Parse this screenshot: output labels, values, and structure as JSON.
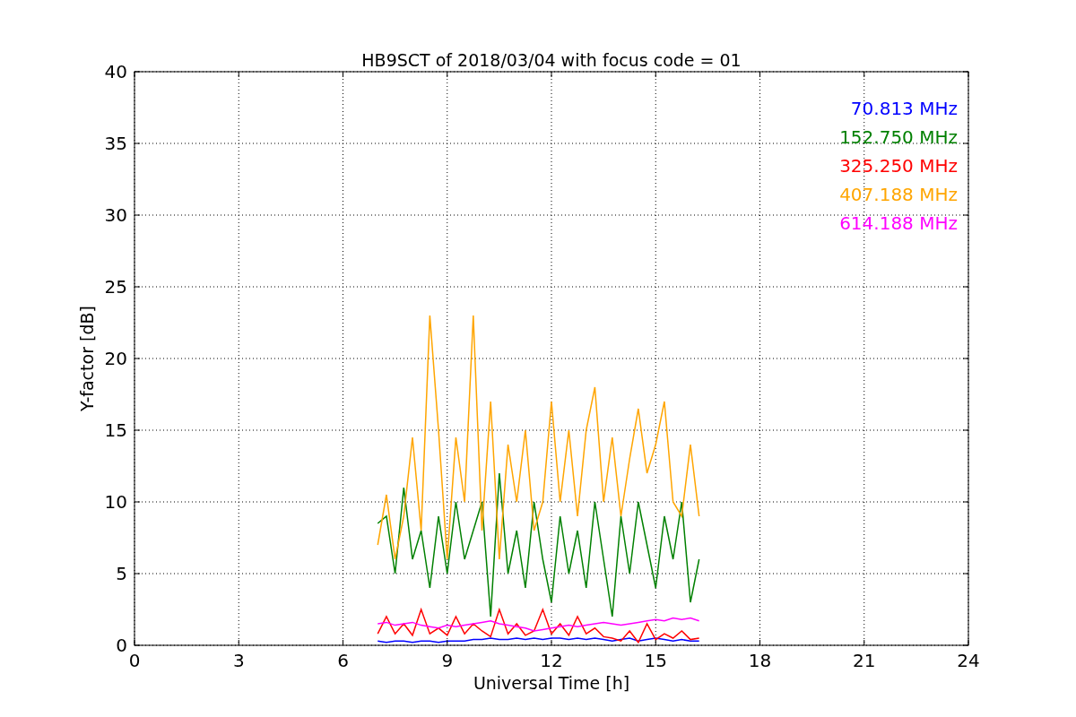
{
  "chart_data": {
    "type": "line",
    "title": "HB9SCT of 2018/03/04 with focus code = 01",
    "xlabel": "Universal Time [h]",
    "ylabel": "Y-factor [dB]",
    "x": [
      7,
      7.25,
      7.5,
      7.75,
      8,
      8.25,
      8.5,
      8.75,
      9,
      9.25,
      9.5,
      9.75,
      10,
      10.25,
      10.5,
      10.75,
      11,
      11.25,
      11.5,
      11.75,
      12,
      12.25,
      12.5,
      12.75,
      13,
      13.25,
      13.5,
      13.75,
      14,
      14.25,
      14.5,
      14.75,
      15,
      15.25,
      15.5,
      15.75,
      16,
      16.25
    ],
    "series": [
      {
        "name": "70.813 MHz",
        "color": "#0000ff",
        "values": [
          0.3,
          0.2,
          0.3,
          0.3,
          0.2,
          0.3,
          0.3,
          0.2,
          0.3,
          0.3,
          0.3,
          0.4,
          0.4,
          0.5,
          0.4,
          0.4,
          0.5,
          0.4,
          0.5,
          0.4,
          0.5,
          0.5,
          0.4,
          0.5,
          0.4,
          0.5,
          0.4,
          0.3,
          0.4,
          0.5,
          0.3,
          0.4,
          0.5,
          0.4,
          0.3,
          0.4,
          0.3,
          0.3
        ]
      },
      {
        "name": "152.750 MHz",
        "color": "#008000",
        "values": [
          8.5,
          9,
          5,
          11,
          6,
          8,
          4,
          9,
          5,
          10,
          6,
          8,
          10,
          2,
          12,
          5,
          8,
          4,
          10,
          6,
          3,
          9,
          5,
          8,
          4,
          10,
          6,
          2,
          9,
          5,
          10,
          7,
          4,
          9,
          6,
          10,
          3,
          6
        ]
      },
      {
        "name": "325.250 MHz",
        "color": "#ff0000",
        "values": [
          0.8,
          2,
          0.8,
          1.5,
          0.7,
          2.5,
          0.8,
          1.2,
          0.7,
          2,
          0.8,
          1.5,
          1,
          0.6,
          2.5,
          0.8,
          1.5,
          0.7,
          1,
          2.5,
          0.8,
          1.5,
          0.7,
          2,
          0.8,
          1.2,
          0.6,
          0.5,
          0.3,
          1,
          0.2,
          1.5,
          0.4,
          0.8,
          0.5,
          1,
          0.4,
          0.5
        ]
      },
      {
        "name": "407.188 MHz",
        "color": "#ffa500",
        "values": [
          7,
          10.5,
          6,
          9,
          14.5,
          8,
          23,
          15,
          6,
          14.5,
          10,
          23,
          8,
          17,
          6,
          14,
          10,
          15,
          8,
          10,
          17,
          10,
          15,
          9,
          15,
          18,
          10,
          14.5,
          9,
          13,
          16.5,
          12,
          14,
          17,
          10,
          9,
          14,
          9
        ]
      },
      {
        "name": "614.188 MHz",
        "color": "#ff00ff",
        "values": [
          1.5,
          1.6,
          1.4,
          1.5,
          1.6,
          1.4,
          1.3,
          1.2,
          1.4,
          1.3,
          1.4,
          1.5,
          1.6,
          1.7,
          1.5,
          1.4,
          1.3,
          1.2,
          1.0,
          1.1,
          1.2,
          1.3,
          1.4,
          1.3,
          1.4,
          1.5,
          1.6,
          1.5,
          1.4,
          1.5,
          1.6,
          1.7,
          1.8,
          1.7,
          1.9,
          1.8,
          1.9,
          1.7
        ]
      }
    ],
    "xlim": [
      0,
      24
    ],
    "ylim": [
      0,
      40
    ],
    "xticks": [
      0,
      3,
      6,
      9,
      12,
      15,
      18,
      21,
      24
    ],
    "yticks": [
      0,
      5,
      10,
      15,
      20,
      25,
      30,
      35,
      40
    ],
    "grid": true
  }
}
